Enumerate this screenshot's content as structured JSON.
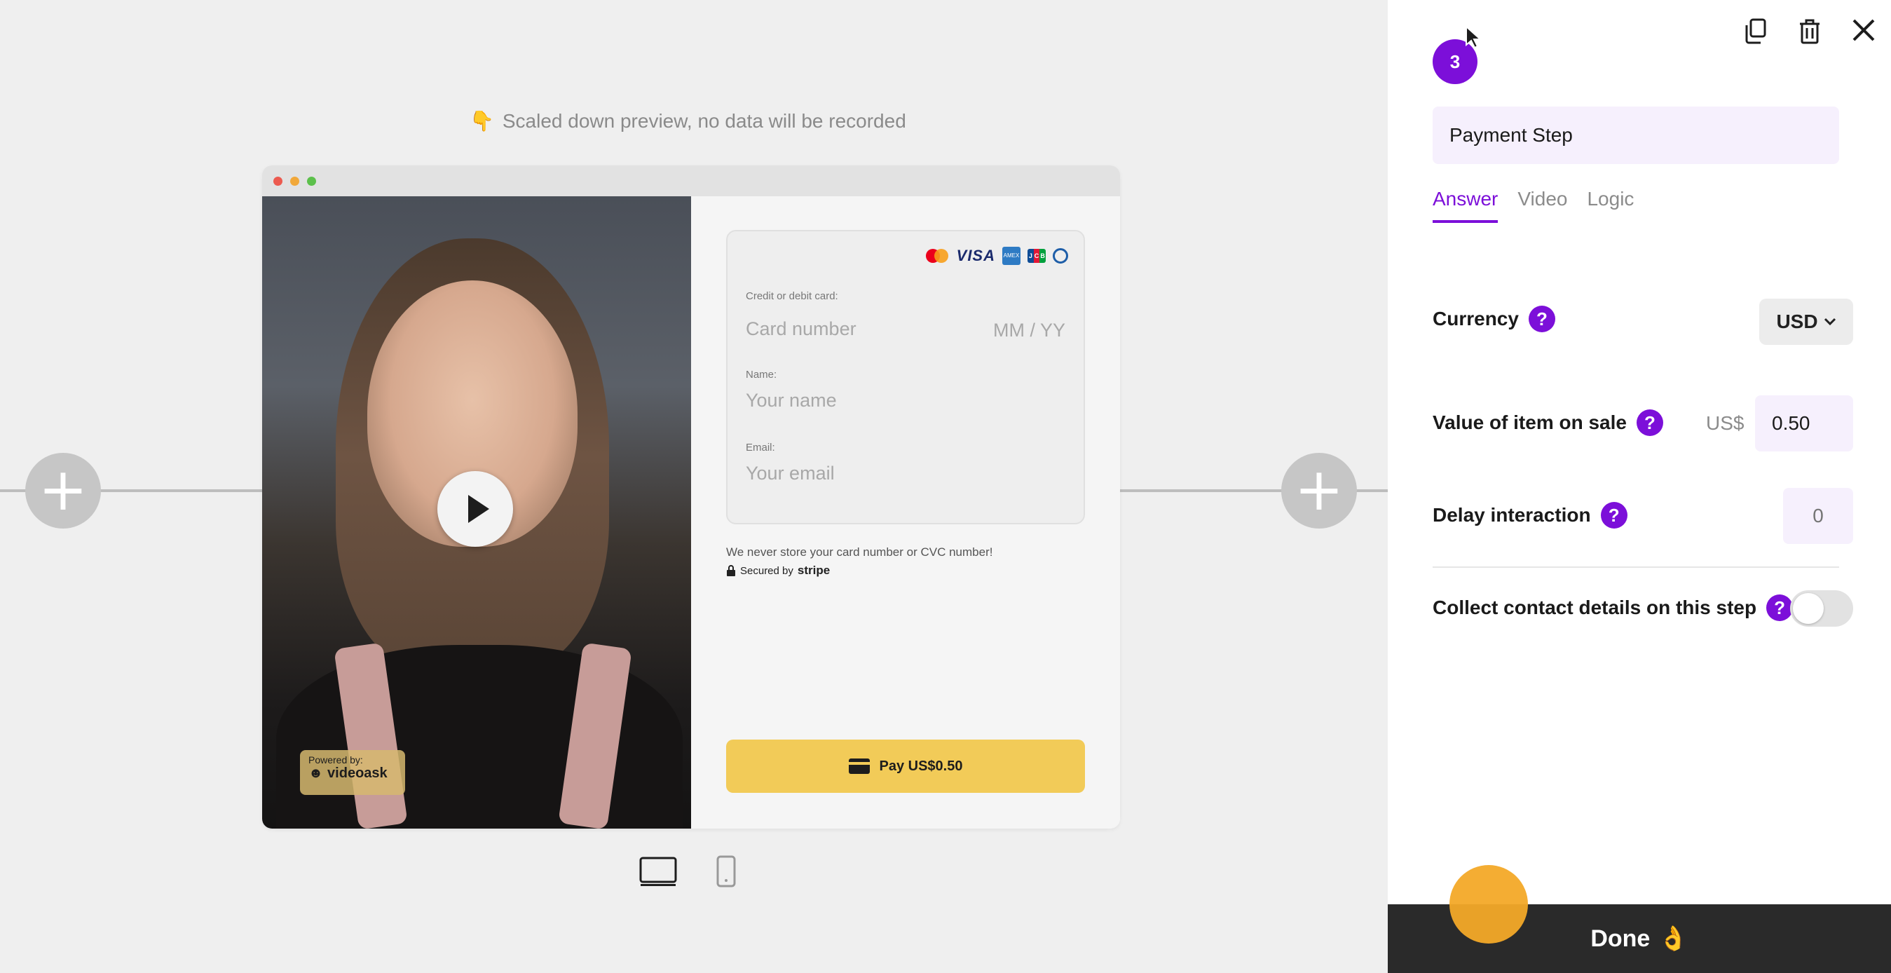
{
  "preview": {
    "note": "Scaled down preview, no data will be recorded",
    "note_emoji": "👇"
  },
  "colors": {
    "accent": "#7c0fd9",
    "pay_button": "#f2cb58",
    "done_bar": "#2a2a2a"
  },
  "video": {
    "powered_small": "Powered by:",
    "powered_brand": "videoask"
  },
  "payment_form": {
    "card_label": "Credit or debit card:",
    "card_placeholder": "Card number",
    "expiry_placeholder": "MM / YY",
    "name_label": "Name:",
    "name_placeholder": "Your name",
    "email_label": "Email:",
    "email_placeholder": "Your email",
    "never_store": "We never store your card number or CVC number!",
    "secured_by": "Secured by",
    "stripe": "stripe",
    "pay_button": "Pay US$0.50",
    "card_brands": [
      "mastercard",
      "visa",
      "amex",
      "jcb",
      "diners"
    ]
  },
  "panel": {
    "step_number": "3",
    "step_name": "Payment Step",
    "tabs": [
      {
        "label": "Answer",
        "active": true
      },
      {
        "label": "Video",
        "active": false
      },
      {
        "label": "Logic",
        "active": false
      }
    ],
    "currency": {
      "label": "Currency",
      "help": "?",
      "value": "USD"
    },
    "item_value": {
      "label": "Value of item on sale",
      "help": "?",
      "prefix": "US$",
      "value": "0.50"
    },
    "delay": {
      "label": "Delay interaction",
      "help": "?",
      "placeholder": "0"
    },
    "collect": {
      "label": "Collect contact details on this step",
      "help": "?",
      "enabled": false
    },
    "done": "Done",
    "done_emoji": "👌"
  }
}
